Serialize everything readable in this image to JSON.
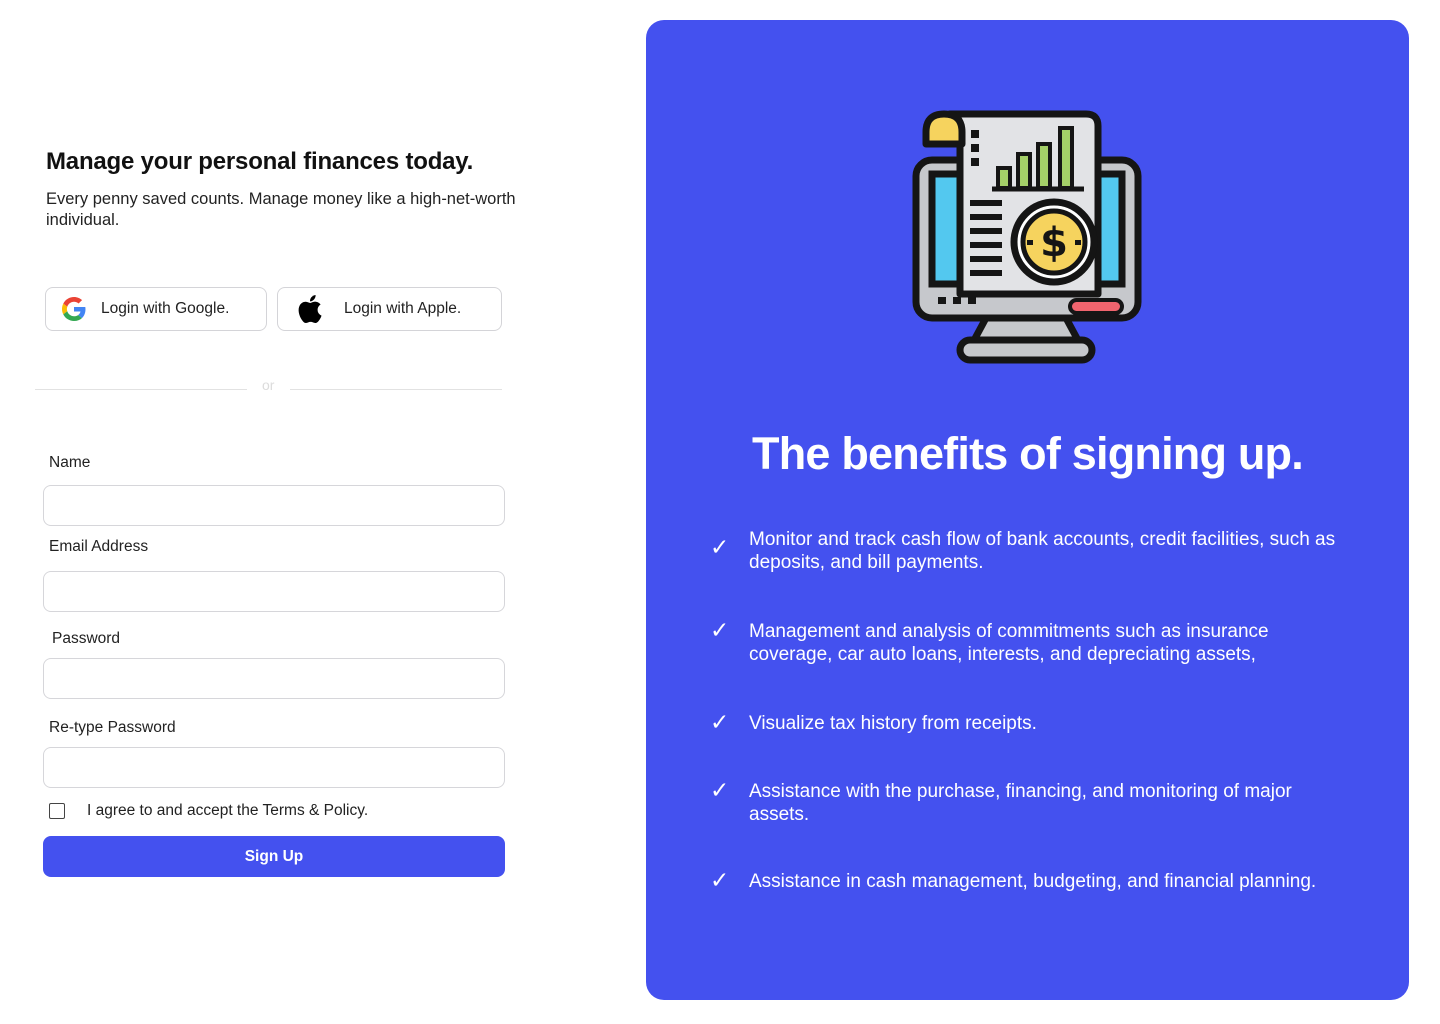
{
  "signup": {
    "heading": "Manage your personal finances today.",
    "subtext": "Every penny saved counts. Manage money like a high-net-worth individual.",
    "google_label": "Login with Google.",
    "apple_label": "Login with Apple.",
    "divider_text": "or",
    "fields": {
      "name_label": "Name",
      "email_label": "Email Address",
      "password_label": "Password",
      "retype_label": "Re-type Password"
    },
    "agree_text": "I agree to and accept the Terms & Policy.",
    "submit_label": "Sign Up"
  },
  "benefits": {
    "title": "The benefits of signing up.",
    "check_glyph": "✓",
    "items": [
      "Monitor and track cash flow of bank accounts, credit facilities, such as deposits, and bill payments.",
      "Management and analysis of commitments such as insurance coverage, car auto loans, interests, and depreciating assets,",
      "Visualize tax history from receipts.",
      "Assistance with the purchase, financing, and monitoring of major assets.",
      "Assistance in cash management, budgeting, and financial planning."
    ]
  },
  "colors": {
    "accent": "#4451ef",
    "panel_text": "#ffffff",
    "illustration_coin": "#f6d35e",
    "illustration_screen": "#53c8ef",
    "illustration_bars": "#a4cf68",
    "illustration_button": "#f0646e"
  },
  "icons": [
    "google-icon",
    "apple-icon",
    "finance-monitor-icon",
    "checkmark-icon"
  ]
}
